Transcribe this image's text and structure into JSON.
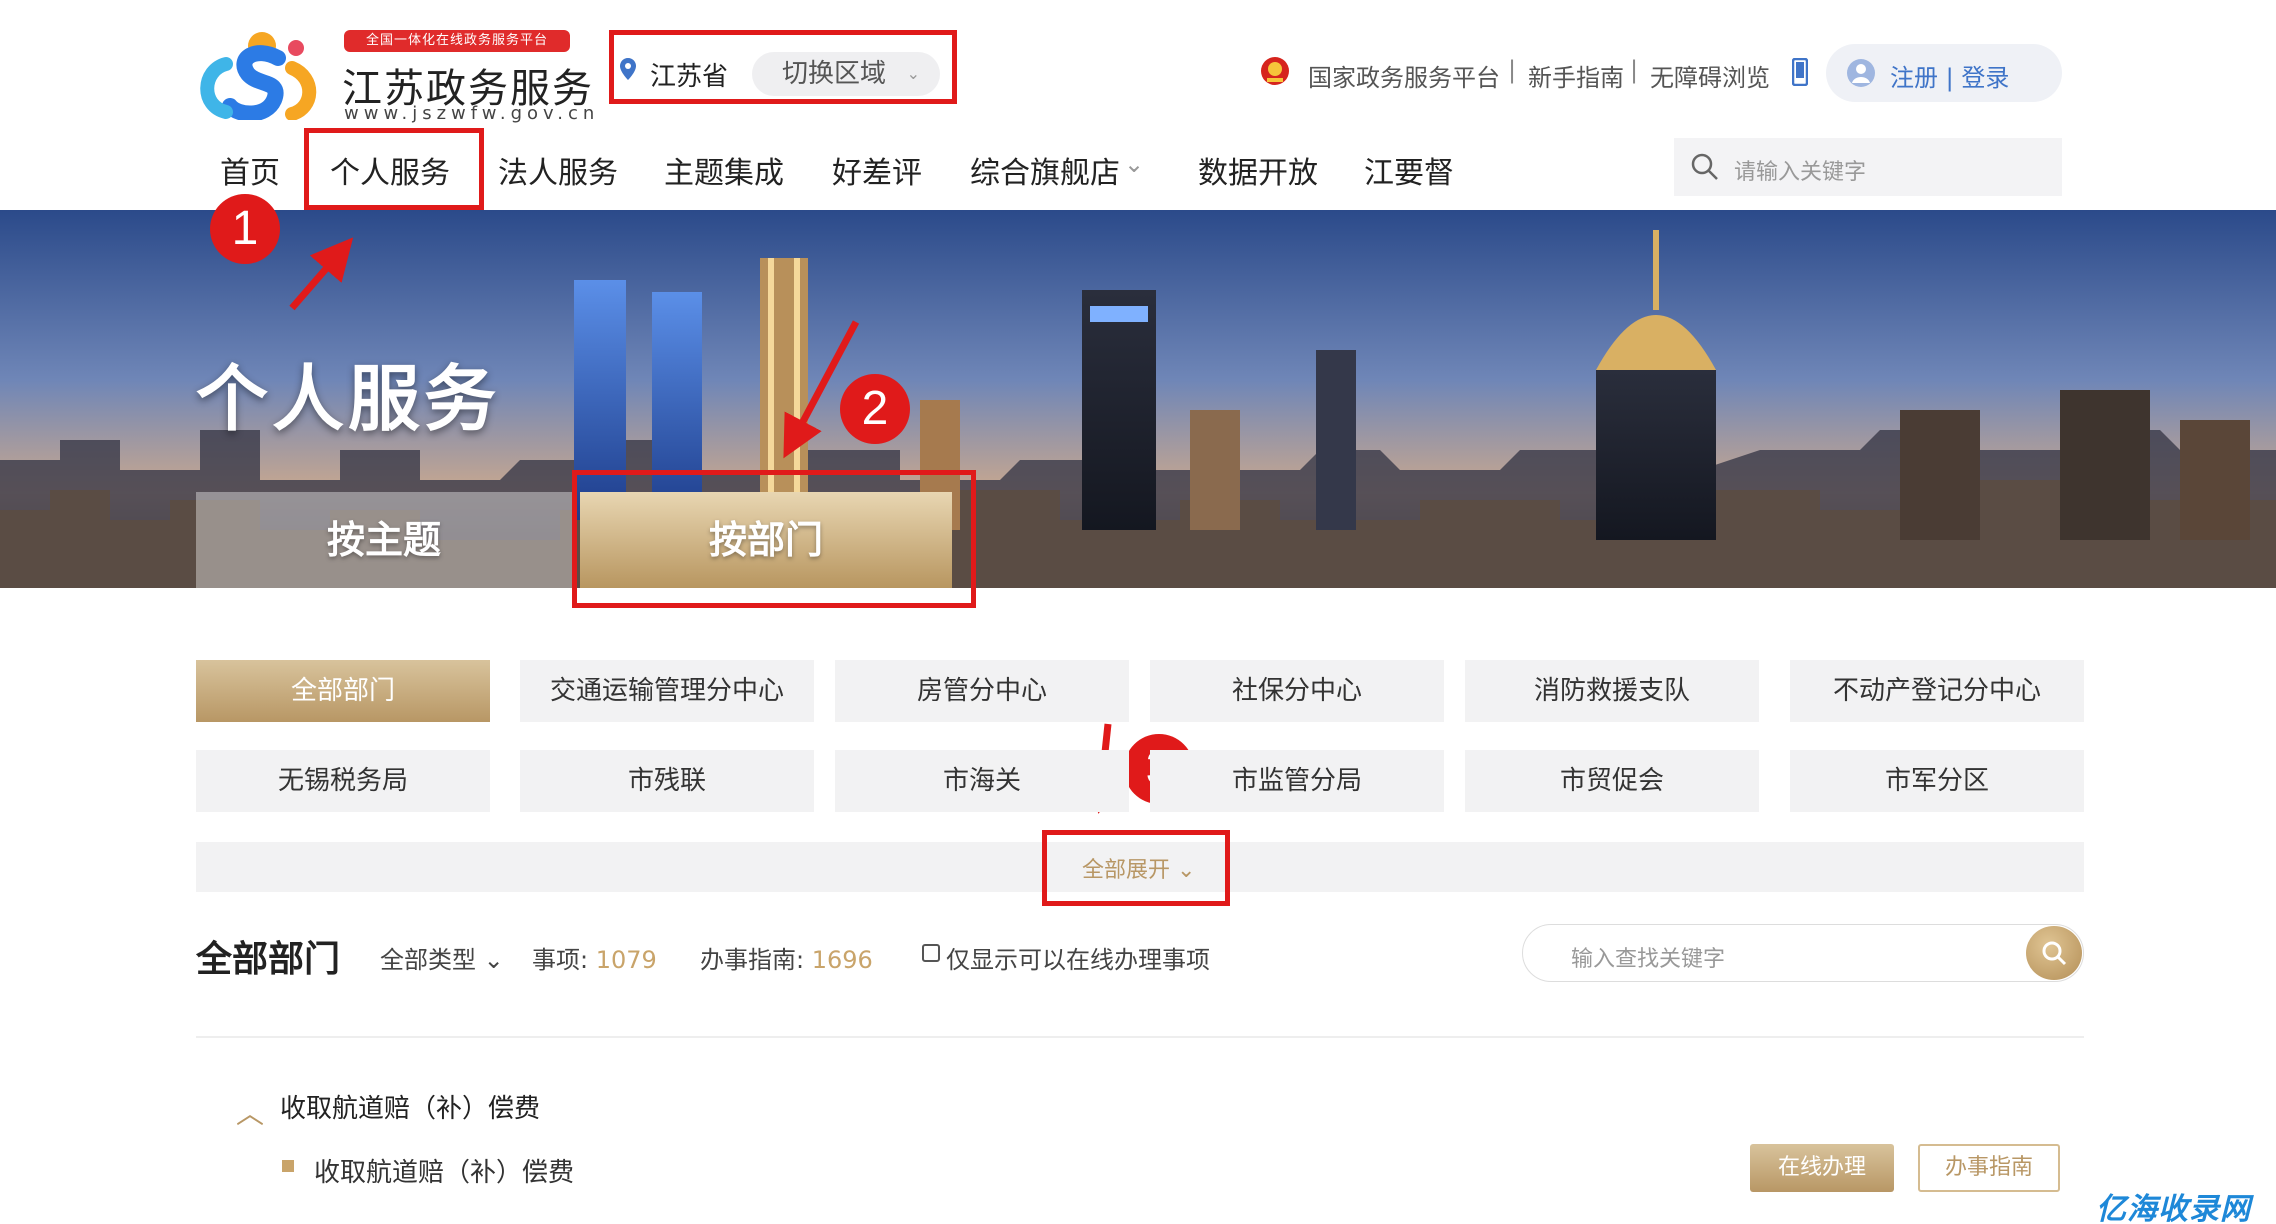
{
  "header": {
    "logo_tagline": "全国一体化在线政务服务平台",
    "logo_title": "江苏政务服务",
    "logo_url": "www.jszwfw.gov.cn",
    "region": "江苏省",
    "region_switch": "切换区域",
    "top_links": [
      "国家政务服务平台",
      "新手指南",
      "无障碍浏览"
    ],
    "separator": "|",
    "login_text": "注册 | 登录"
  },
  "nav": {
    "items": [
      "首页",
      "个人服务",
      "法人服务",
      "主题集成",
      "好差评",
      "综合旗舰店",
      "数据开放",
      "江要督"
    ],
    "dropdown_marker": "⌄",
    "search_placeholder": "请输入关键字"
  },
  "banner": {
    "title": "个人服务",
    "tabs": [
      "按主题",
      "按部门"
    ],
    "active_tab": "按部门"
  },
  "annotations": [
    "1",
    "2",
    "3"
  ],
  "departments": {
    "row1": [
      "全部部门",
      "交通运输管理分中心",
      "房管分中心",
      "社保分中心",
      "消防救援支队",
      "不动产登记分中心"
    ],
    "row2": [
      "无锡税务局",
      "市残联",
      "市海关",
      "市监管分局",
      "市贸促会",
      "市军分区"
    ],
    "active": "全部部门",
    "expand_label": "全部展开"
  },
  "filter": {
    "section_title": "全部部门",
    "type_label": "全部类型",
    "items_label": "事项:",
    "items_count": "1079",
    "guides_label": "办事指南:",
    "guides_count": "1696",
    "online_only_label": "仅显示可以在线办理事项",
    "search_placeholder": "输入查找关键字"
  },
  "results": {
    "group_title": "收取航道赔（补）偿费",
    "item_title": "收取航道赔（补）偿费",
    "online_button": "在线办理",
    "guide_button": "办事指南"
  },
  "watermark": "亿海收录网",
  "colors": {
    "accent_gold": "#b89765",
    "annotation_red": "#e01a1a",
    "login_blue": "#3f74c8",
    "tag_red": "#e02b2b"
  }
}
